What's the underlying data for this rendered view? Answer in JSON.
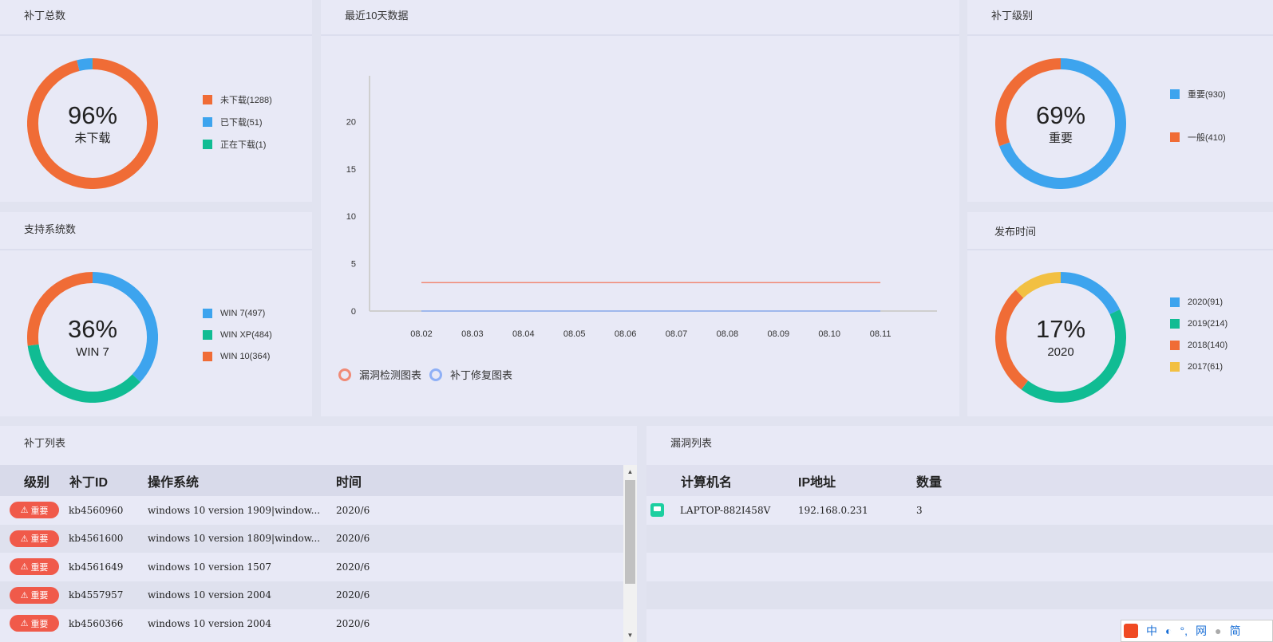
{
  "colors": {
    "orange": "#f06c36",
    "blue": "#3da4ee",
    "green": "#10bc93",
    "yellow": "#f2c042",
    "detect_line": "#f08a76",
    "repair_line": "#8fb0f6",
    "badge_red": "#f05a4a"
  },
  "patch_total": {
    "title": "补丁总数",
    "percent": "96%",
    "label": "未下载",
    "legend": [
      {
        "label": "未下载(1288)",
        "color": "#f06c36",
        "value": 1288
      },
      {
        "label": "已下载(51)",
        "color": "#3da4ee",
        "value": 51
      },
      {
        "label": "正在下载(1)",
        "color": "#10bc93",
        "value": 1
      }
    ]
  },
  "supported_systems": {
    "title": "支持系统数",
    "percent": "36%",
    "label": "WIN 7",
    "legend": [
      {
        "label": "WIN 7(497)",
        "color": "#3da4ee",
        "value": 497
      },
      {
        "label": "WIN XP(484)",
        "color": "#10bc93",
        "value": 484
      },
      {
        "label": "WIN 10(364)",
        "color": "#f06c36",
        "value": 364
      }
    ]
  },
  "patch_level": {
    "title": "补丁级别",
    "percent": "69%",
    "label": "重要",
    "legend": [
      {
        "label": "重要(930)",
        "color": "#3da4ee",
        "value": 930
      },
      {
        "label": "一般(410)",
        "color": "#f06c36",
        "value": 410
      }
    ]
  },
  "release_time": {
    "title": "发布时间",
    "percent": "17%",
    "label": "2020",
    "legend": [
      {
        "label": "2020(91)",
        "color": "#3da4ee",
        "value": 91
      },
      {
        "label": "2019(214)",
        "color": "#10bc93",
        "value": 214
      },
      {
        "label": "2018(140)",
        "color": "#f06c36",
        "value": 140
      },
      {
        "label": "2017(61)",
        "color": "#f2c042",
        "value": 61
      }
    ]
  },
  "recent": {
    "title": "最近10天数据",
    "legend_detect": "漏洞检测图表",
    "legend_repair": "补丁修复图表"
  },
  "chart_data": {
    "type": "line",
    "x": [
      "08.02",
      "08.03",
      "08.04",
      "08.05",
      "08.06",
      "08.07",
      "08.08",
      "08.09",
      "08.10",
      "08.11"
    ],
    "y_ticks": [
      "0",
      "5",
      "10",
      "15",
      "20"
    ],
    "ylim": [
      0,
      25
    ],
    "series": [
      {
        "name": "漏洞检测图表",
        "color": "#f08a76",
        "values": [
          3,
          3,
          3,
          3,
          3,
          3,
          3,
          3,
          3,
          3
        ]
      },
      {
        "name": "补丁修复图表",
        "color": "#8fb0f6",
        "values": [
          0,
          0,
          0,
          0,
          0,
          0,
          0,
          0,
          0,
          0
        ]
      }
    ]
  },
  "patch_list": {
    "title": "补丁列表",
    "columns": [
      "级别",
      "补丁ID",
      "操作系统",
      "时间"
    ],
    "rows": [
      {
        "level": "重要",
        "id": "kb4560960",
        "os": "windows 10 version 1909|window...",
        "time": "2020/6"
      },
      {
        "level": "重要",
        "id": "kb4561600",
        "os": "windows 10 version 1809|window...",
        "time": "2020/6"
      },
      {
        "level": "重要",
        "id": "kb4561649",
        "os": "windows 10 version 1507",
        "time": "2020/6"
      },
      {
        "level": "重要",
        "id": "kb4557957",
        "os": "windows 10 version 2004",
        "time": "2020/6"
      },
      {
        "level": "重要",
        "id": "kb4560366",
        "os": "windows 10 version 2004",
        "time": "2020/6"
      }
    ]
  },
  "vuln_list": {
    "title": "漏洞列表",
    "columns": [
      "计算机名",
      "IP地址",
      "数量"
    ],
    "rows": [
      {
        "name": "LAPTOP-882I458V",
        "ip": "192.168.0.231",
        "count": "3"
      }
    ]
  },
  "ime": [
    "中",
    "网",
    "简"
  ]
}
